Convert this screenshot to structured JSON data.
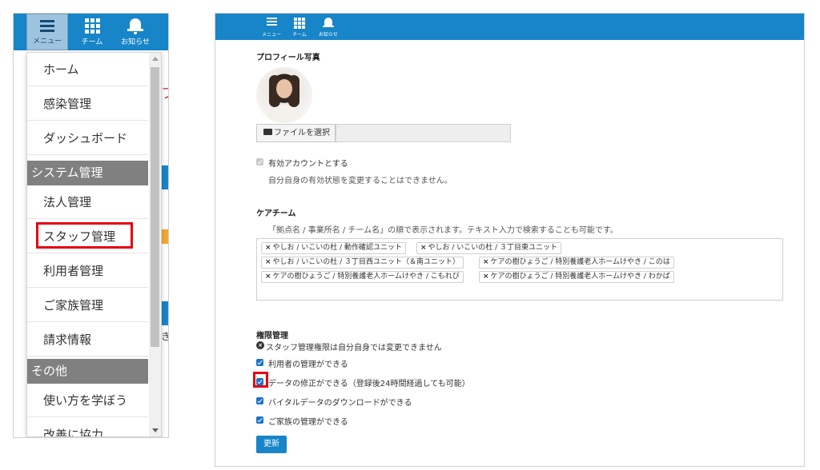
{
  "nav": {
    "menu_label": "メニュー",
    "team_label": "チーム",
    "notify_label": "お知らせ"
  },
  "dropdown": {
    "items": [
      {
        "label": "ホーム"
      },
      {
        "label": "感染管理"
      },
      {
        "label": "ダッシュボード"
      },
      {
        "header": "システム管理"
      },
      {
        "label": "法人管理"
      },
      {
        "label": "スタッフ管理",
        "highlighted": true
      },
      {
        "label": "利用者管理"
      },
      {
        "label": "ご家族管理"
      },
      {
        "label": "請求情報"
      },
      {
        "header": "その他"
      },
      {
        "label": "使い方を学ぼう"
      },
      {
        "label": "改善に協力"
      }
    ],
    "background_fragments": [
      "フ",
      "き"
    ]
  },
  "form": {
    "profile_photo_title": "プロフィール写真",
    "file_button_label": "ファイルを選択",
    "file_name": "",
    "active_account_label": "有効アカウントとする",
    "active_account_checked": true,
    "active_account_disabled": true,
    "active_account_note": "自分自身の有効状態を変更することはできません。",
    "care_team_title": "ケアチーム",
    "care_team_hint": "「拠点名 / 事業所名 / チーム名」の順で表示されます。テキスト入力で検索することも可能です。",
    "care_team_tags": [
      "やしお / いこいの杜 / 動作確認ユニット",
      "やしお / いこいの杜 / ３丁目東ユニット",
      "やしお / いこいの杜 / ３丁目西ユニット（＆南ユニット）",
      "ケアの樹ひょうご / 特別養護老人ホームけやき / このは",
      "ケアの樹ひょうご / 特別養護老人ホームけやき / こもれび",
      "ケアの樹ひょうご / 特別養護老人ホームけやき / わかば"
    ],
    "tag_remove_glyph": "×",
    "permissions_title": "権限管理",
    "permissions_notice": "スタッフ管理権限は自分自身では変更できません",
    "notice_icon_glyph": "×",
    "permissions": [
      {
        "label": "利用者の管理ができる",
        "checked": true
      },
      {
        "label": "データの修正ができる（登録後24時間経過しても可能）",
        "checked": true,
        "highlighted": true
      },
      {
        "label": "バイタルデータのダウンロードができる",
        "checked": true
      },
      {
        "label": "ご家族の管理ができる",
        "checked": true
      }
    ],
    "update_button_label": "更新"
  },
  "colors": {
    "header_blue": "#1785c7",
    "highlight_red": "#e60012",
    "section_header_gray": "#808080"
  },
  "icons": [
    "hamburger-icon",
    "team-grid-icon",
    "bell-icon",
    "folder-open-icon",
    "x-circle-icon",
    "checkbox-checked-icon"
  ]
}
